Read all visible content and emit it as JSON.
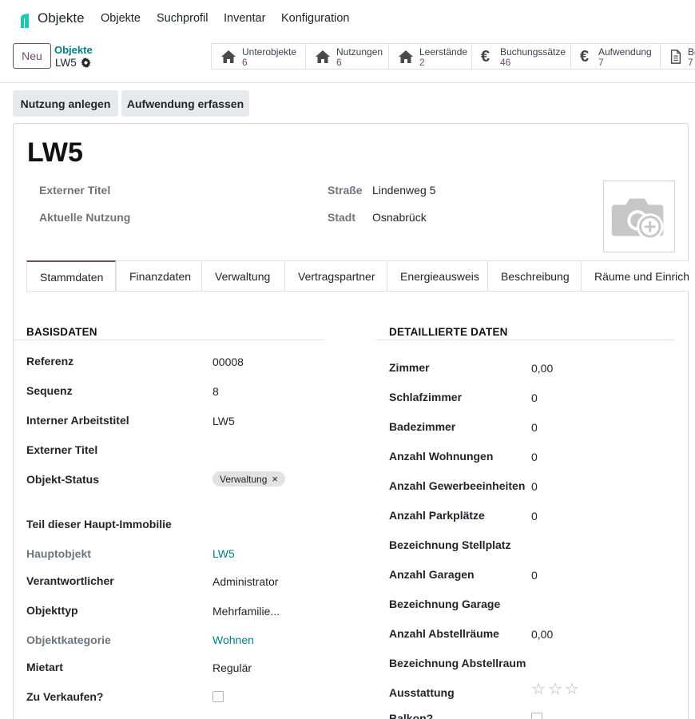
{
  "app": {
    "name": "Objekte",
    "logo_color": "#1ec9b3"
  },
  "menu": [
    {
      "label": "Objekte"
    },
    {
      "label": "Suchprofil"
    },
    {
      "label": "Inventar"
    },
    {
      "label": "Konfiguration"
    }
  ],
  "control": {
    "new_label": "Neu",
    "breadcrumb_parent": "Objekte",
    "breadcrumb_current": "LW5",
    "gear_icon": "gear-icon"
  },
  "smart_buttons": [
    {
      "label": "Unterobjekte",
      "count": "6",
      "icon": "home-icon"
    },
    {
      "label": "Nutzungen",
      "count": "6",
      "icon": "home-icon"
    },
    {
      "label": "Leerstände",
      "count": "2",
      "icon": "home-icon"
    },
    {
      "label": "Buchungssätze",
      "count": "46",
      "icon": "euro-icon"
    },
    {
      "label": "Aufwendung",
      "count": "7",
      "icon": "euro-icon"
    },
    {
      "label": "Be",
      "count": "7",
      "icon": "document-icon"
    }
  ],
  "actions": {
    "nutzung": "Nutzung anlegen",
    "aufwendung": "Aufwendung erfassen"
  },
  "record": {
    "title": "LW5",
    "external_title_label": "Externer Titel",
    "current_usage_label": "Aktuelle Nutzung",
    "street_label": "Straße",
    "street_value": "Lindenweg 5",
    "city_label": "Stadt",
    "city_value": "Osnabrück"
  },
  "tabs": [
    {
      "label": "Stammdaten"
    },
    {
      "label": "Finanzdaten"
    },
    {
      "label": "Verwaltung"
    },
    {
      "label": "Vertragspartner"
    },
    {
      "label": "Energieausweis"
    },
    {
      "label": "Beschreibung"
    },
    {
      "label": "Räume und Einricht"
    }
  ],
  "basis": {
    "heading": "BASISDATEN",
    "fields": [
      {
        "label": "Referenz",
        "value": "00008"
      },
      {
        "label": "Sequenz",
        "value": "8"
      },
      {
        "label": "Interner Arbeitstitel",
        "value": "LW5"
      },
      {
        "label": "Externer Titel",
        "value": ""
      },
      {
        "label": "Objekt-Status",
        "value": "Verwaltung"
      },
      {
        "label": "Teil dieser Haupt-Immobilie",
        "value": ""
      },
      {
        "label": "Hauptobjekt",
        "value": "LW5"
      },
      {
        "label": "Verantwortlicher",
        "value": "Administrator"
      },
      {
        "label": "Objekttyp",
        "value": "Mehrfamilie..."
      },
      {
        "label": "Objektkategorie",
        "value": "Wohnen"
      },
      {
        "label": "Mietart",
        "value": "Regulär"
      },
      {
        "label": "Zu Verkaufen?",
        "value": ""
      }
    ],
    "zu_verkaufen_checked": false
  },
  "detail": {
    "heading": "DETAILLIERTE DATEN",
    "fields": [
      {
        "label": "Zimmer",
        "value": "0,00"
      },
      {
        "label": "Schlafzimmer",
        "value": "0"
      },
      {
        "label": "Badezimmer",
        "value": "0"
      },
      {
        "label": "Anzahl Wohnungen",
        "value": "0"
      },
      {
        "label": "Anzahl Gewerbeeinheiten",
        "value": "0"
      },
      {
        "label": "Anzahl Parkplätze",
        "value": "0"
      },
      {
        "label": "Bezeichnung Stellplatz",
        "value": ""
      },
      {
        "label": "Anzahl Garagen",
        "value": "0"
      },
      {
        "label": "Bezeichnung Garage",
        "value": ""
      },
      {
        "label": "Anzahl Abstellräume",
        "value": "0,00"
      },
      {
        "label": "Bezeichnung Abstellraum",
        "value": ""
      },
      {
        "label": "Ausstattung",
        "value": ""
      },
      {
        "label": "Balkon?",
        "value": ""
      }
    ],
    "ausstattung_stars": 0,
    "balkon_checked": false
  }
}
